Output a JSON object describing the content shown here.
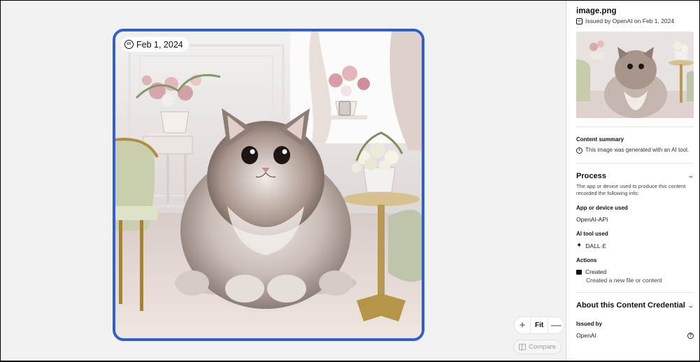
{
  "image": {
    "date_badge": "Feb 1, 2024",
    "alt": "fluffy cat illustration"
  },
  "zoom": {
    "zoom_in": "+",
    "fit": "Fit",
    "zoom_out": "—"
  },
  "compare": {
    "label": "Compare"
  },
  "panel": {
    "file_name": "image.png",
    "issued_line": "Issued by OpenAI on Feb 1, 2024",
    "content_summary": {
      "label": "Content summary",
      "text": "This image was generated with an AI tool."
    },
    "process": {
      "title": "Process",
      "description": "The app or device used to produce this content recorded the following info:",
      "app_label": "App or device used",
      "app_value": "OpenAI-API",
      "tool_label": "AI tool used",
      "tool_value": "DALL·E",
      "actions_label": "Actions",
      "action_name": "Created",
      "action_desc": "Created a new file or content"
    },
    "about": {
      "title": "About this Content Credential",
      "issued_by_label": "Issued by",
      "issuer": "OpenAI"
    }
  },
  "colors": {
    "frame_border": "#2f5fd0",
    "background": "#f2f2f2",
    "panel": "#ffffff"
  },
  "icons": [
    "cr-icon",
    "plus-icon",
    "minus-icon",
    "compare-icon",
    "info-icon",
    "chevron-down-icon",
    "dalle-icon",
    "action-icon",
    "help-icon"
  ]
}
